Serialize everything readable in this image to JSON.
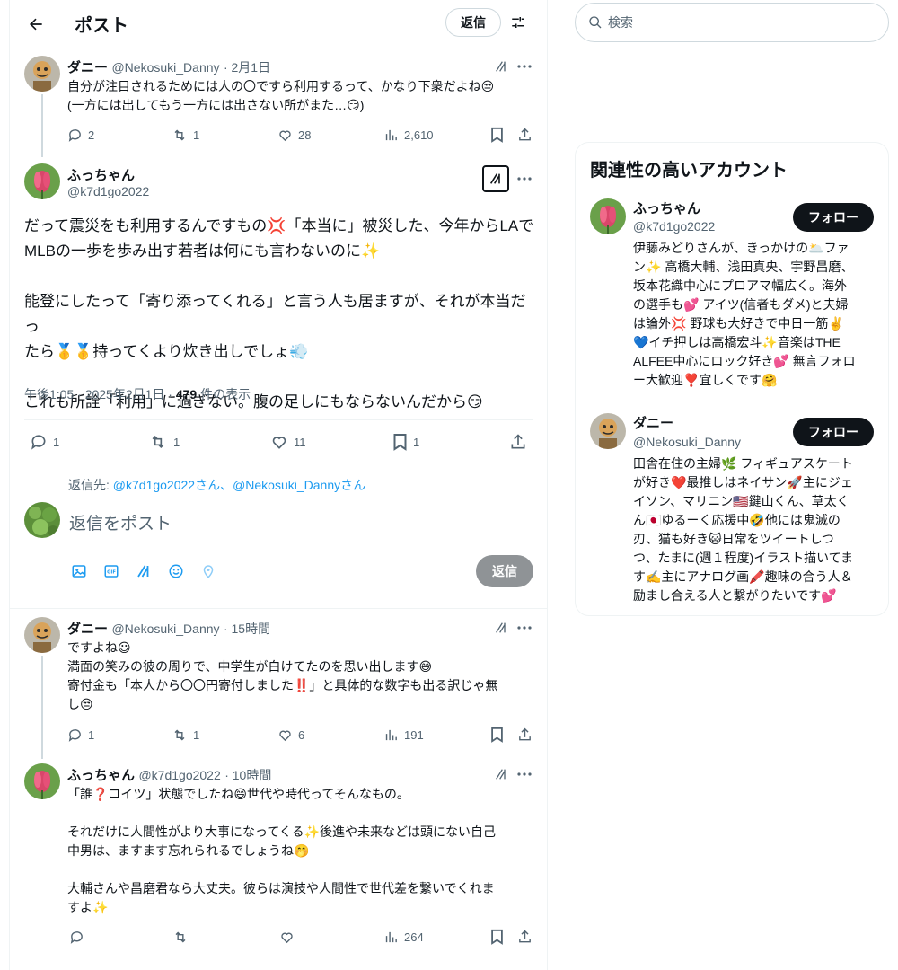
{
  "header": {
    "title": "ポスト",
    "reply_label": "返信"
  },
  "tweets": [
    {
      "name": "ダニー",
      "handle": "@Nekosuki_Danny",
      "date": "· 2月1日",
      "text_lines": [
        "自分が注目されるためには人の〇ですら利用するって、かなり下衆だよね😒",
        "(一方には出してもう一方には出さない所がまた…😏)"
      ],
      "replies": "2",
      "retweets": "1",
      "likes": "28",
      "views": "2,610"
    },
    {
      "name": "ふっちゃん",
      "handle": "@k7d1go2022",
      "paragraphs": [
        [
          "だって震災をも利用するんですもの💢「本当に」被災した、今年からLAで",
          "MLBの一歩を歩み出す若者は何にも言わないのに✨"
        ],
        [
          "能登にしたって「寄り添ってくれる」と言う人も居ますが、それが本当だっ",
          "たら🥇🥇持ってくより炊き出しでしょ💨"
        ],
        [
          "これも所詮「利用」に過ぎない。腹の足しにもならないんだから😏"
        ]
      ],
      "timestamp": "午後1:05 · 2025年2月1日 · ",
      "views_count": "479",
      "views_suffix": " 件の表示",
      "replies": "1",
      "retweets": "1",
      "likes": "11",
      "bookmarks": "1"
    },
    {
      "name": "ダニー",
      "handle": "@Nekosuki_Danny",
      "date": "· 15時間",
      "text_lines": [
        "ですよね😃",
        "満面の笑みの彼の周りで、中学生が白けてたのを思い出します😅",
        "寄付金も「本人から〇〇円寄付しました‼️」と具体的な数字も出る訳じゃ無",
        "し😒"
      ],
      "replies": "1",
      "retweets": "1",
      "likes": "6",
      "views": "191"
    },
    {
      "name": "ふっちゃん",
      "handle": "@k7d1go2022",
      "date": "· 10時間",
      "text_lines": [
        "「誰❓コイツ」状態でしたね😄世代や時代ってそんなもの。",
        "",
        "それだけに人間性がより大事になってくる✨後進や未来などは頭にない自己",
        "中男は、ますます忘れられるでしょうね🤭",
        "",
        "大輔さんや昌磨君なら大丈夫。彼らは演技や人間性で世代差を繋いでくれま",
        "すよ✨"
      ],
      "views": "264"
    }
  ],
  "composer": {
    "reply_to_prefix": "返信先: ",
    "reply_to_users": "@k7d1go2022さん、@Nekosuki_Dannyさん",
    "placeholder": "返信をポスト",
    "submit_label": "返信"
  },
  "sidebar": {
    "search_placeholder": "検索",
    "related_title": "関連性の高いアカウント",
    "accounts": [
      {
        "name": "ふっちゃん",
        "handle": "@k7d1go2022",
        "follow_label": "フォロー",
        "bio_lines": [
          "伊藤みどりさんが、きっかけの🌥️ファ",
          "ン✨ 高橋大輔、浅田真央、宇野昌磨、",
          "坂本花織中心にプロアマ幅広く。海外",
          "の選手も💕 アイツ(信者もダメ)と夫婦",
          "は論外💢 野球も大好きで中日一筋✌️",
          "💙イチ押しは高橋宏斗✨音楽はTHE",
          "ALFEE中心にロック好き💕 無言フォロ",
          "ー大歓迎❣️宜しくです🤗"
        ]
      },
      {
        "name": "ダニー",
        "handle": "@Nekosuki_Danny",
        "follow_label": "フォロー",
        "bio_lines": [
          "田舎在住の主婦🌿 フィギュアスケート",
          "が好き❤️最推しはネイサン🚀主にジェ",
          "イソン、マリニン🇺🇸鍵山くん、草太く",
          "ん🇯🇵ゆるーく応援中🤣他には鬼滅の",
          "刃、猫も好き😺日常をツイートしつ",
          "つ、たまに(週１程度)イラスト描いてま",
          "す✍️主にアナログ画🖍️趣味の合う人＆",
          "励まし合える人と繋がりたいです💕"
        ]
      }
    ]
  }
}
